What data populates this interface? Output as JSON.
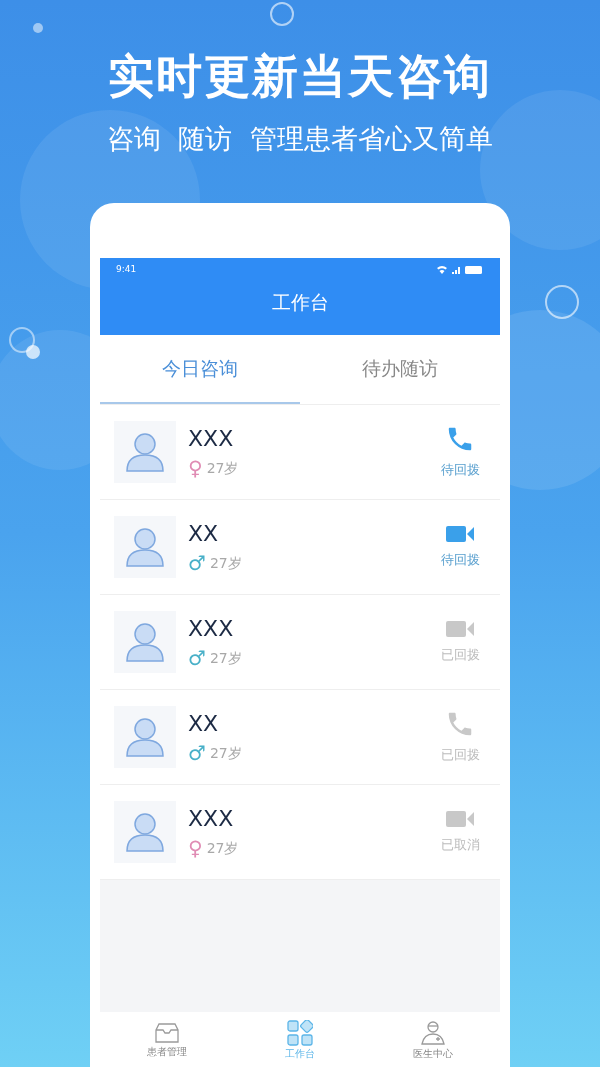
{
  "headline": "实时更新当天咨询",
  "subtitle": "咨询  随访  管理患者省心又简单",
  "status_bar": {
    "time": "9:41"
  },
  "header": {
    "title": "工作台"
  },
  "tabs": [
    {
      "label": "今日咨询",
      "selected": true
    },
    {
      "label": "待办随访",
      "selected": false
    }
  ],
  "rows": [
    {
      "name": "XXX",
      "gender": {
        "kind": "female",
        "symbol": "♀"
      },
      "age": "27岁",
      "kind": "call",
      "pending": true,
      "status": "待回拨"
    },
    {
      "name": "XX",
      "gender": {
        "kind": "male",
        "symbol": "♂"
      },
      "age": "27岁",
      "kind": "video",
      "pending": true,
      "status": "待回拨"
    },
    {
      "name": "XXX",
      "gender": {
        "kind": "male",
        "symbol": "♂"
      },
      "age": "27岁",
      "kind": "video",
      "pending": false,
      "status": "已回拨"
    },
    {
      "name": "XX",
      "gender": {
        "kind": "male",
        "symbol": "♂"
      },
      "age": "27岁",
      "kind": "call",
      "pending": false,
      "status": "已回拨"
    },
    {
      "name": "XXX",
      "gender": {
        "kind": "female",
        "symbol": "♀"
      },
      "age": "27岁",
      "kind": "video",
      "pending": false,
      "status": "已取消"
    }
  ],
  "nav": [
    {
      "label": "患者管理",
      "kind": "tray",
      "selected": false
    },
    {
      "label": "工作台",
      "kind": "grid",
      "selected": true
    },
    {
      "label": "医生中心",
      "kind": "doctor",
      "selected": false
    }
  ]
}
